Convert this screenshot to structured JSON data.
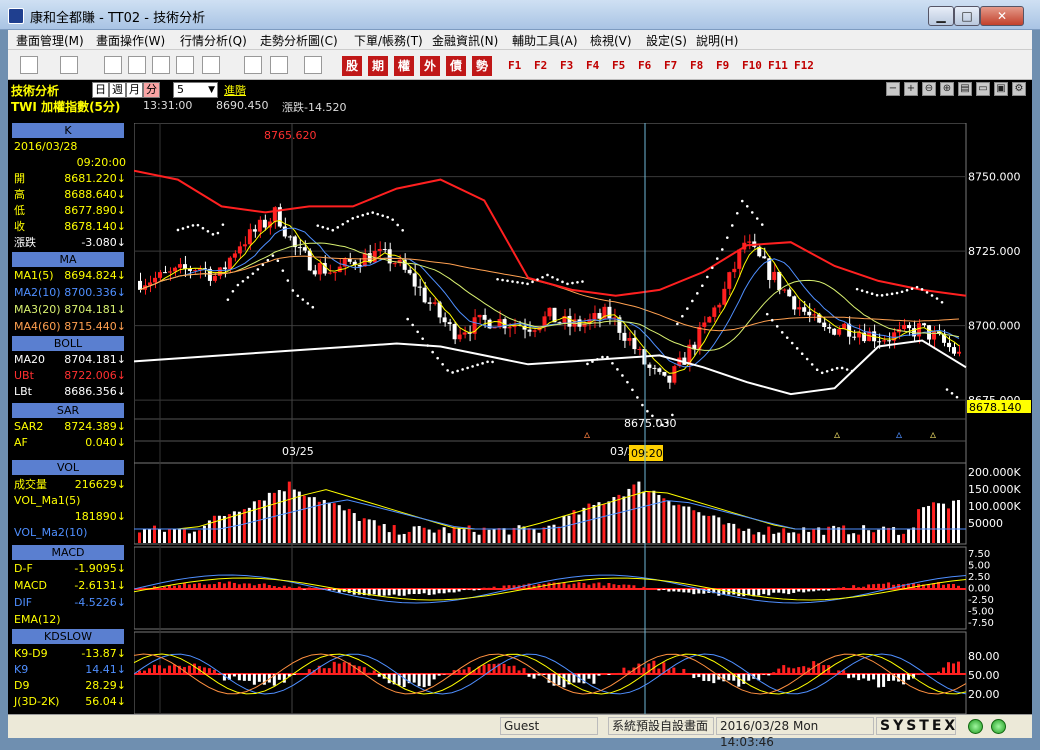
{
  "window": {
    "title": "康和全都賺 - TT02 - 技術分析",
    "minimize": "▁",
    "maximize": "□",
    "close": "✕"
  },
  "menu": [
    "畫面管理(M)",
    "畫面操作(W)",
    "行情分析(Q)",
    "走勢分析圖(C)",
    "下單/帳務(T)",
    "金融資訊(N)",
    "輔助工具(A)",
    "檢視(V)",
    "設定(S)",
    "說明(H)"
  ],
  "toolbar": {
    "icons": [
      "layout-icon",
      "monitor-icon",
      "zoom-icon",
      "close-chart-icon",
      "table-icon",
      "split-icon",
      "refresh-icon",
      "link-icon",
      "chart-window-icon",
      "company-logo-icon"
    ],
    "category_buttons": [
      "股",
      "期",
      "權",
      "外",
      "債",
      "勢"
    ],
    "function_keys": [
      "F1",
      "F2",
      "F3",
      "F4",
      "F5",
      "F6",
      "F7",
      "F8",
      "F9",
      "F10",
      "F11",
      "F12"
    ]
  },
  "panel": {
    "title": "技術分析",
    "timeframes": [
      "日",
      "週",
      "月",
      "分"
    ],
    "active_timeframe": "分",
    "period": "5",
    "advance": "進階"
  },
  "info": {
    "symbol": "TWI  加權指數(5分)",
    "time": "13:31:00",
    "price": "8690.450",
    "change": "漲跌-14.520"
  },
  "title_icons": [
    "minus-icon",
    "plus-icon",
    "zoom-out-icon",
    "zoom-in-icon",
    "print-icon",
    "save-icon",
    "window-icon",
    "settings-icon"
  ],
  "left": {
    "k": {
      "label": "K",
      "date": "2016/03/28",
      "time": "09:20:00",
      "rows": [
        {
          "k": "開",
          "v": "8681.220↓"
        },
        {
          "k": "高",
          "v": "8688.640↓"
        },
        {
          "k": "低",
          "v": "8677.890↓"
        },
        {
          "k": "收",
          "v": "8678.140↓"
        },
        {
          "k": "漲跌",
          "v": "-3.080↓"
        }
      ]
    },
    "ma": {
      "label": "MA",
      "rows": [
        {
          "k": "MA1(5)",
          "v": "8694.824↓",
          "c": "#ffff00"
        },
        {
          "k": "MA2(10)",
          "v": "8700.336↓",
          "c": "#4f8fff"
        },
        {
          "k": "MA3(20)",
          "v": "8704.181↓",
          "c": "#d8f070"
        },
        {
          "k": "MA4(60)",
          "v": "8715.440↓",
          "c": "#ffa050"
        }
      ]
    },
    "boll": {
      "label": "BOLL",
      "rows": [
        {
          "k": "MA20",
          "v": "8704.181↓",
          "c": "#ffffff"
        },
        {
          "k": "UBt",
          "v": "8722.006↓",
          "c": "#ff3030"
        },
        {
          "k": "LBt",
          "v": "8686.356↓",
          "c": "#ffffff"
        }
      ]
    },
    "sar": {
      "label": "SAR",
      "rows": [
        {
          "k": "SAR2",
          "v": "8724.389↓",
          "c": "#ffff00"
        },
        {
          "k": "AF",
          "v": "0.040↓",
          "c": "#ffff00"
        }
      ]
    },
    "vol": {
      "label": "VOL",
      "rows": [
        {
          "k": "成交量",
          "v": "216629↓",
          "c": "#ffff00"
        },
        {
          "k": "VOL_Ma1(5)",
          "v": "",
          "c": "#ffff00"
        },
        {
          "k": "",
          "v": "181890↓",
          "c": "#ffff00"
        },
        {
          "k": "VOL_Ma2(10)",
          "v": "",
          "c": "#4f8fff"
        }
      ]
    },
    "macd": {
      "label": "MACD",
      "rows": [
        {
          "k": "D-F",
          "v": "-1.9095↓",
          "c": "#ffff00"
        },
        {
          "k": "MACD",
          "v": "-2.6131↓",
          "c": "#ffff00"
        },
        {
          "k": "DIF",
          "v": "-4.5226↓",
          "c": "#4f8fff"
        },
        {
          "k": "EMA(12)",
          "v": "",
          "c": "#ffff00"
        }
      ]
    },
    "kd": {
      "label": "KDSLOW",
      "rows": [
        {
          "k": "K9-D9",
          "v": "-13.87↓",
          "c": "#ffff00"
        },
        {
          "k": "K9",
          "v": "14.41↓",
          "c": "#4f8fff"
        },
        {
          "k": "D9",
          "v": "28.29↓",
          "c": "#ffff00"
        },
        {
          "k": "J(3D-2K)",
          "v": "56.04↓",
          "c": "#ffff00"
        }
      ]
    }
  },
  "chart_data": [
    {
      "type": "candlestick",
      "title": "TWI 加權指數(5分)",
      "ylim": [
        8670,
        8768
      ],
      "yticks": [
        "8750.000",
        "8725.000",
        "8700.000",
        "8675.000"
      ],
      "current_price": "8678.140",
      "high_label": "8765.620",
      "low_label": "8675.030",
      "x_labels": [
        "03/25",
        "03/28"
      ],
      "cursor_label": "09:20",
      "series": [
        {
          "name": "BOLL UBt",
          "color": "#ff2020",
          "values": [
            8752,
            8749,
            8740,
            8738,
            8740,
            8740,
            8746,
            8749,
            8742,
            8716,
            8712,
            8710,
            8712,
            8718,
            8727,
            8728,
            8720,
            8715,
            8712,
            8710
          ]
        },
        {
          "name": "BOLL LBt",
          "color": "#ffffff",
          "values": [
            8688,
            8689,
            8690,
            8691,
            8692,
            8693,
            8694,
            8693,
            8690,
            8687,
            8688,
            8689,
            8690,
            8686,
            8681,
            8677,
            8679,
            8693,
            8695,
            8686
          ]
        }
      ]
    },
    {
      "type": "bar",
      "title": "VOL",
      "yticks": [
        "200.000K",
        "150.000K",
        "100.000K",
        "50000"
      ]
    },
    {
      "type": "bar",
      "title": "MACD",
      "yticks": [
        "7.50",
        "5.00",
        "2.50",
        "0.00",
        "-2.50",
        "-5.00",
        "-7.50"
      ]
    },
    {
      "type": "line",
      "title": "KDSLOW",
      "yticks": [
        "80.00",
        "50.00",
        "20.00"
      ]
    }
  ],
  "status": {
    "user": "Guest",
    "layout": "系統預設自設畫面",
    "datetime": "2016/03/28 Mon 14:03:46",
    "brand": "SYSTEX"
  }
}
